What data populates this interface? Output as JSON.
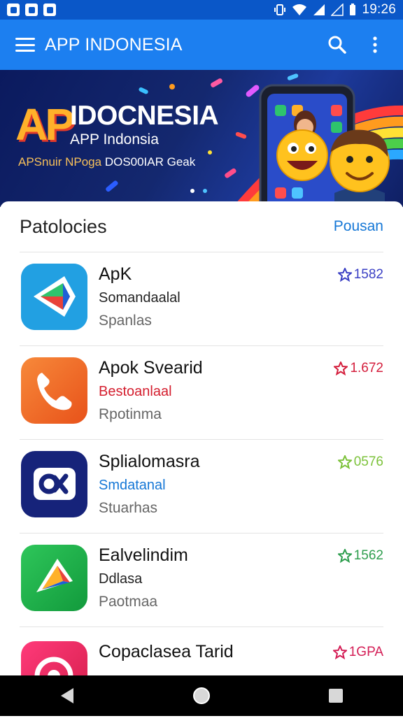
{
  "status_bar": {
    "time": "19:26"
  },
  "app_bar": {
    "title": "APP INDONESIA",
    "menu_icon": "hamburger-menu-icon",
    "search_icon": "search-icon",
    "more_icon": "more-vert-icon"
  },
  "banner": {
    "logo_letters": "AP",
    "title": "IDOCNESIA",
    "subtitle": "APP Indonsia",
    "tagline_highlight": "APSnuir NPoga",
    "tagline_rest": "DOS00IAR Geak",
    "colors": {
      "background": "#14286f",
      "accent": "#ffb12a"
    }
  },
  "section": {
    "title": "Patolocies",
    "link": "Pousan"
  },
  "apps": [
    {
      "name": "ApK",
      "subtitle": "Somandaalal",
      "subtitle_color": "#222222",
      "subtitle2": "Spanlas",
      "rating": "1582",
      "rating_color": "#3a3fc4",
      "icon": "play-triangle-icon",
      "icon_bg": "#1f9bde"
    },
    {
      "name": "Apok Svearid",
      "subtitle": "Bestoanlaal",
      "subtitle_color": "#d41e2e",
      "subtitle2": "Rpotinma",
      "rating": "1.672",
      "rating_color": "#d41e3c",
      "icon": "phone-icon",
      "icon_bg": "#f26a1e"
    },
    {
      "name": "Splialomasra",
      "subtitle": "Smdatanal",
      "subtitle_color": "#1577d6",
      "subtitle2": "Stuarhas",
      "rating": "0576",
      "rating_color": "#7cc23a",
      "icon": "link-icon",
      "icon_bg": "#16237a"
    },
    {
      "name": "Ealvelindim",
      "subtitle": "Ddlasa",
      "subtitle_color": "#222222",
      "subtitle2": "Paotmaa",
      "rating": "1562",
      "rating_color": "#2e9e4e",
      "icon": "play-triangle-icon",
      "icon_bg": "#1fb04a"
    },
    {
      "name": "Copaclasea Tarid",
      "subtitle": "",
      "subtitle_color": "#222222",
      "subtitle2": "",
      "rating": "1GPA",
      "rating_color": "#d41e56",
      "icon": "music-icon",
      "icon_bg": "#e22a5a"
    }
  ],
  "nav_bar": {
    "back_icon": "back-icon",
    "home_icon": "home-icon",
    "recents_icon": "recents-icon"
  }
}
